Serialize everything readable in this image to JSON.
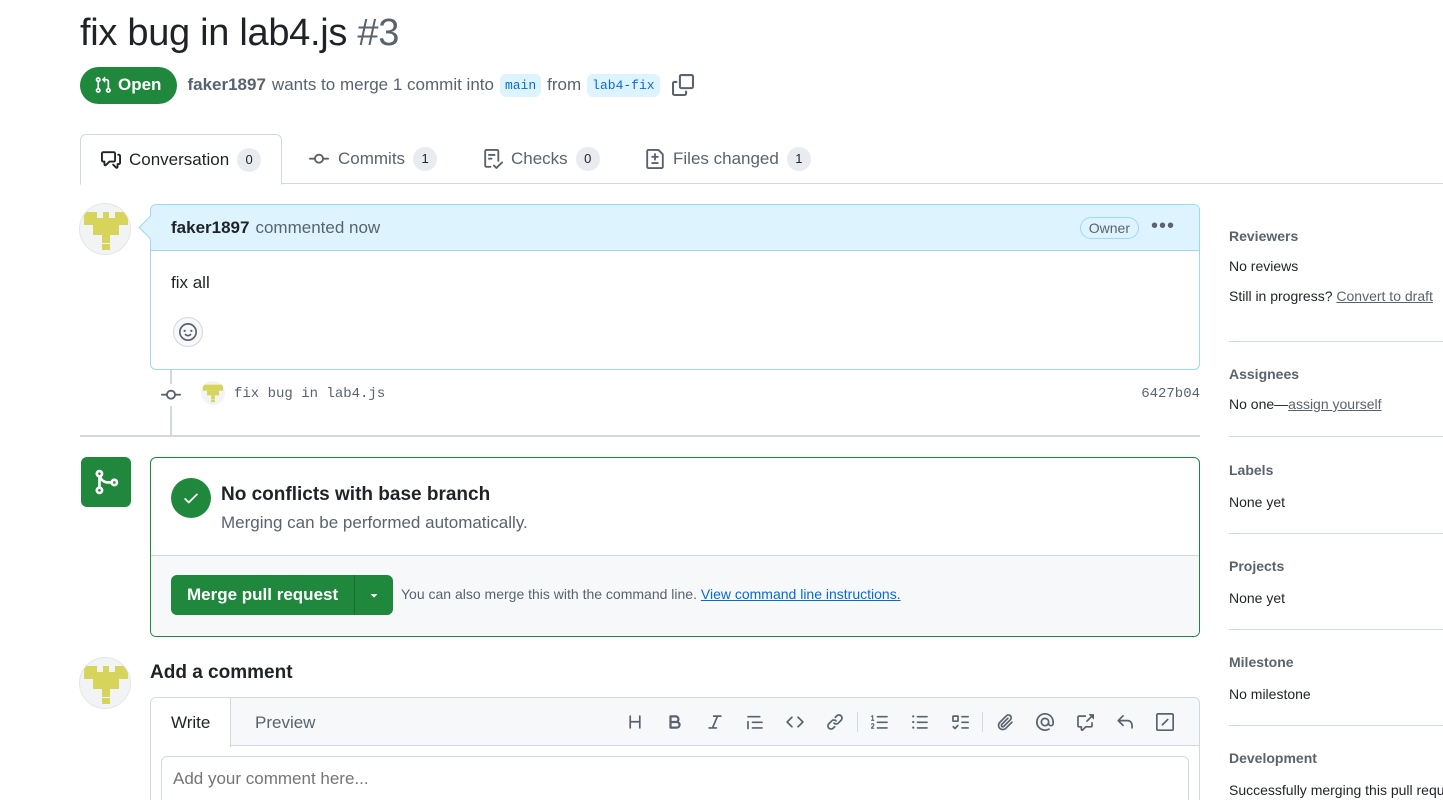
{
  "pr": {
    "title": "fix bug in lab4.js",
    "number": "#3",
    "state": "Open",
    "author": "faker1897",
    "merge_text": "wants to merge 1 commit into",
    "base_branch": "main",
    "from_text": "from",
    "head_branch": "lab4-fix"
  },
  "tabs": [
    {
      "label": "Conversation",
      "count": "0",
      "icon": "comment-discussion-icon"
    },
    {
      "label": "Commits",
      "count": "1",
      "icon": "git-commit-icon"
    },
    {
      "label": "Checks",
      "count": "0",
      "icon": "checklist-icon"
    },
    {
      "label": "Files changed",
      "count": "1",
      "icon": "file-diff-icon"
    }
  ],
  "comment": {
    "author": "faker1897",
    "meta": "commented now",
    "role": "Owner",
    "body": "fix all"
  },
  "commit": {
    "message": "fix bug in lab4.js",
    "sha": "6427b04"
  },
  "merge": {
    "title": "No conflicts with base branch",
    "subtitle": "Merging can be performed automatically.",
    "button": "Merge pull request",
    "hint": "You can also merge this with the command line.",
    "hint_link": "View command line instructions."
  },
  "add_comment": {
    "title": "Add a comment",
    "tab_write": "Write",
    "tab_preview": "Preview",
    "placeholder": "Add your comment here..."
  },
  "sidebar": {
    "reviewers": {
      "heading": "Reviewers",
      "line1": "No reviews",
      "line2_prefix": "Still in progress?",
      "line2_link": "Convert to draft"
    },
    "assignees": {
      "heading": "Assignees",
      "prefix": "No one—",
      "link": "assign yourself"
    },
    "labels": {
      "heading": "Labels",
      "value": "None yet"
    },
    "projects": {
      "heading": "Projects",
      "value": "None yet"
    },
    "milestone": {
      "heading": "Milestone",
      "value": "No milestone"
    },
    "development": {
      "heading": "Development",
      "value": "Successfully merging this pull request may close these issues."
    }
  },
  "colors": {
    "accent_green": "#1f883d",
    "link_blue": "#0969da",
    "highlight_blue": "#ddf4ff",
    "avatar_yellow": "#d6d45a"
  }
}
